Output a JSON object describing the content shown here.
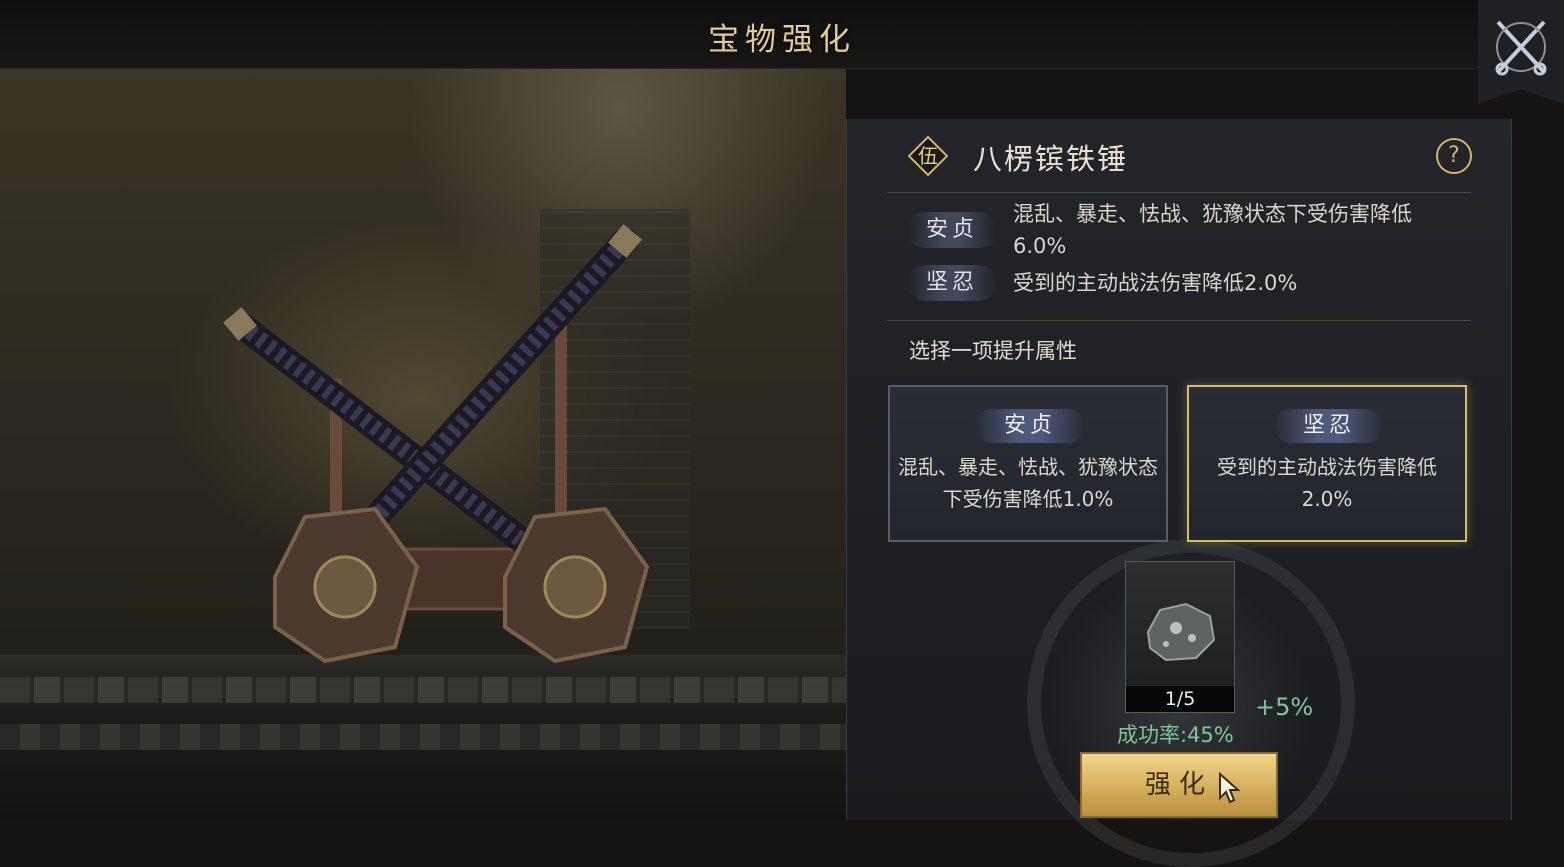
{
  "header": {
    "title": "宝物强化"
  },
  "item": {
    "badge": "伍",
    "name": "八楞镔铁锤",
    "help": "?"
  },
  "attributes": [
    {
      "tag": "安贞",
      "desc": "混乱、暴走、怯战、犹豫状态下受伤害降低6.0%"
    },
    {
      "tag": "坚忍",
      "desc": "受到的主动战法伤害降低2.0%"
    }
  ],
  "selection": {
    "label": "选择一项提升属性",
    "options": [
      {
        "tag": "安贞",
        "desc": "混乱、暴走、怯战、犹豫状态下受伤害降低1.0%",
        "selected": false
      },
      {
        "tag": "坚忍",
        "desc": "受到的主动战法伤害降低2.0%",
        "selected": true
      }
    ]
  },
  "material": {
    "count": "1/5",
    "bonus": "+5%"
  },
  "success_rate": "成功率:45%",
  "enhance_button": "强化",
  "colors": {
    "gold": "#d8bc62",
    "green": "#7fc79a",
    "title": "#e3cc8f"
  }
}
